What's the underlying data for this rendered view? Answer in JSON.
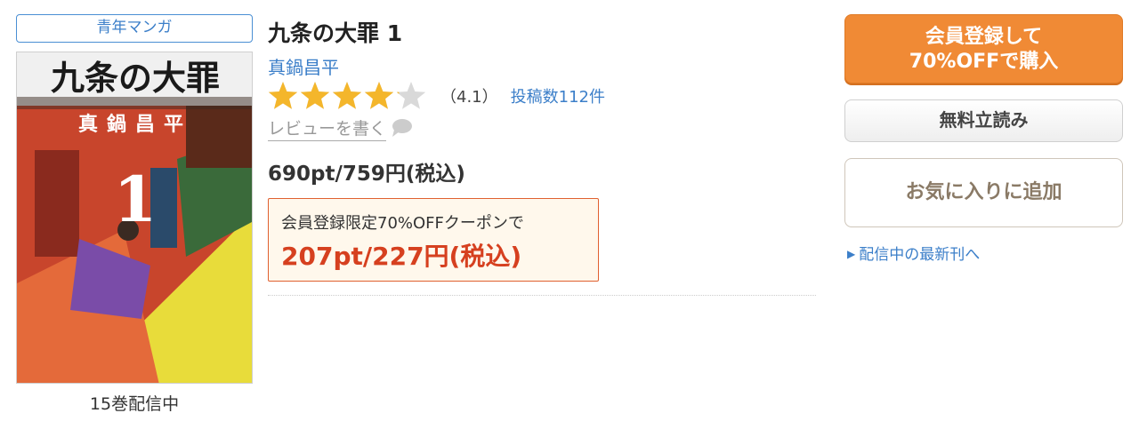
{
  "genre_tag": "青年マンガ",
  "cover": {
    "title_text": "九条の大罪",
    "author_text": "真鍋昌平",
    "volume_number": "1"
  },
  "volumes_label": "15巻配信中",
  "title": "九条の大罪 1",
  "author": "真鍋昌平",
  "rating": {
    "stars_filled": 4.1,
    "stars_total": 5,
    "value_label": "（4.1）",
    "review_count_label": "投稿数112件"
  },
  "write_review_label": "レビューを書く",
  "price": "690pt/759円(税込)",
  "coupon": {
    "label": "会員登録限定70%OFFクーポンで",
    "price": "207pt/227円(税込)"
  },
  "buttons": {
    "buy_line1": "会員登録して",
    "buy_line2": "70%OFFで購入",
    "trial": "無料立読み",
    "favorite": "お気に入りに追加"
  },
  "latest_link": "配信中の最新刊へ",
  "colors": {
    "accent_blue": "#3c7fc9",
    "buy_orange": "#f08a35",
    "coupon_red": "#d6401f",
    "star_gold": "#f4b62b"
  },
  "icons": {
    "bubble": "speech-bubble-icon",
    "link_arrow": "triangle-right-icon"
  }
}
